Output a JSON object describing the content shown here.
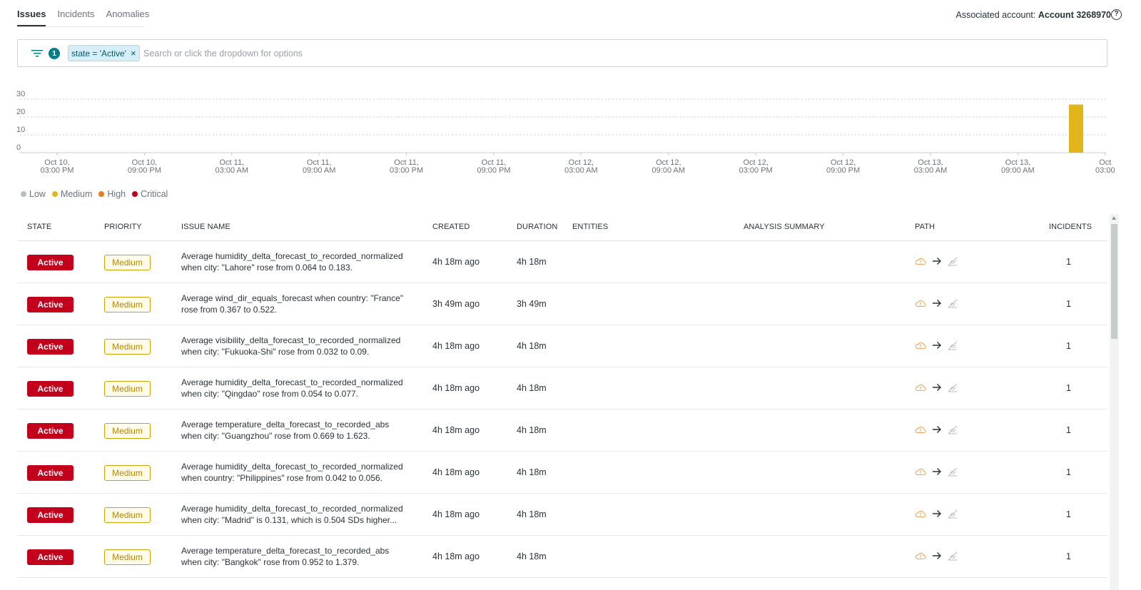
{
  "tabs": [
    {
      "label": "Issues",
      "active": true
    },
    {
      "label": "Incidents",
      "active": false
    },
    {
      "label": "Anomalies",
      "active": false
    }
  ],
  "account": {
    "prefix": "Associated account:",
    "name": "Account 3268970"
  },
  "filter": {
    "count": "1",
    "chip_label": "state = 'Active'",
    "chip_close": "×",
    "placeholder": "Search or click the dropdown for options"
  },
  "chart_data": {
    "type": "bar",
    "y_ticks": [
      "30",
      "20",
      "10",
      "0"
    ],
    "ylim": [
      0,
      30
    ],
    "x_tick_labels": [
      [
        "Oct 10,",
        "03:00 PM"
      ],
      [
        "Oct 10,",
        "09:00 PM"
      ],
      [
        "Oct 11,",
        "03:00 AM"
      ],
      [
        "Oct 11,",
        "09:00 AM"
      ],
      [
        "Oct 11,",
        "03:00 PM"
      ],
      [
        "Oct 11,",
        "09:00 PM"
      ],
      [
        "Oct 12,",
        "03:00 AM"
      ],
      [
        "Oct 12,",
        "09:00 AM"
      ],
      [
        "Oct 12,",
        "03:00 PM"
      ],
      [
        "Oct 12,",
        "09:00 PM"
      ],
      [
        "Oct 13,",
        "03:00 AM"
      ],
      [
        "Oct 13,",
        "09:00 AM"
      ],
      [
        "Oct",
        "03:00"
      ]
    ],
    "bars": [
      {
        "x": "Oct 13, 01:00 PM",
        "series": "Medium",
        "value": 27
      }
    ],
    "grid": true,
    "legend": [
      {
        "name": "Low",
        "color": "#b7bdc0"
      },
      {
        "name": "Medium",
        "color": "#e2b51c"
      },
      {
        "name": "High",
        "color": "#f07a1b"
      },
      {
        "name": "Critical",
        "color": "#c3001c"
      }
    ]
  },
  "table": {
    "headers": {
      "state": "STATE",
      "priority": "PRIORITY",
      "issue_name": "ISSUE NAME",
      "created": "CREATED",
      "duration": "DURATION",
      "entities": "ENTITIES",
      "analysis_summary": "ANALYSIS SUMMARY",
      "path": "PATH",
      "incidents": "INCIDENTS"
    },
    "rows": [
      {
        "state": "Active",
        "priority": "Medium",
        "line1": "Average humidity_delta_forecast_to_recorded_normalized",
        "line2": "when city: \"Lahore\" rose from 0.064 to 0.183.",
        "created": "4h 18m ago",
        "duration": "4h 18m",
        "incidents": "1"
      },
      {
        "state": "Active",
        "priority": "Medium",
        "line1": "Average wind_dir_equals_forecast when country: \"France\"",
        "line2": "rose from 0.367 to 0.522.",
        "created": "3h 49m ago",
        "duration": "3h 49m",
        "incidents": "1"
      },
      {
        "state": "Active",
        "priority": "Medium",
        "line1": "Average visibility_delta_forecast_to_recorded_normalized",
        "line2": "when city: \"Fukuoka-Shi\" rose from 0.032 to 0.09.",
        "created": "4h 18m ago",
        "duration": "4h 18m",
        "incidents": "1"
      },
      {
        "state": "Active",
        "priority": "Medium",
        "line1": "Average humidity_delta_forecast_to_recorded_normalized",
        "line2": "when city: \"Qingdao\" rose from 0.054 to 0.077.",
        "created": "4h 18m ago",
        "duration": "4h 18m",
        "incidents": "1"
      },
      {
        "state": "Active",
        "priority": "Medium",
        "line1": "Average temperature_delta_forecast_to_recorded_abs",
        "line2": "when city: \"Guangzhou\" rose from 0.669 to 1.623.",
        "created": "4h 18m ago",
        "duration": "4h 18m",
        "incidents": "1"
      },
      {
        "state": "Active",
        "priority": "Medium",
        "line1": "Average humidity_delta_forecast_to_recorded_normalized",
        "line2": "when country: \"Philippines\" rose from 0.042 to 0.056.",
        "created": "4h 18m ago",
        "duration": "4h 18m",
        "incidents": "1"
      },
      {
        "state": "Active",
        "priority": "Medium",
        "line1": "Average humidity_delta_forecast_to_recorded_normalized",
        "line2": "when city: \"Madrid\" is 0.131, which is 0.504 SDs higher...",
        "created": "4h 18m ago",
        "duration": "4h 18m",
        "incidents": "1"
      },
      {
        "state": "Active",
        "priority": "Medium",
        "line1": "Average temperature_delta_forecast_to_recorded_abs",
        "line2": "when city: \"Bangkok\" rose from 0.952 to 1.379.",
        "created": "4h 18m ago",
        "duration": "4h 18m",
        "incidents": "1"
      }
    ]
  }
}
